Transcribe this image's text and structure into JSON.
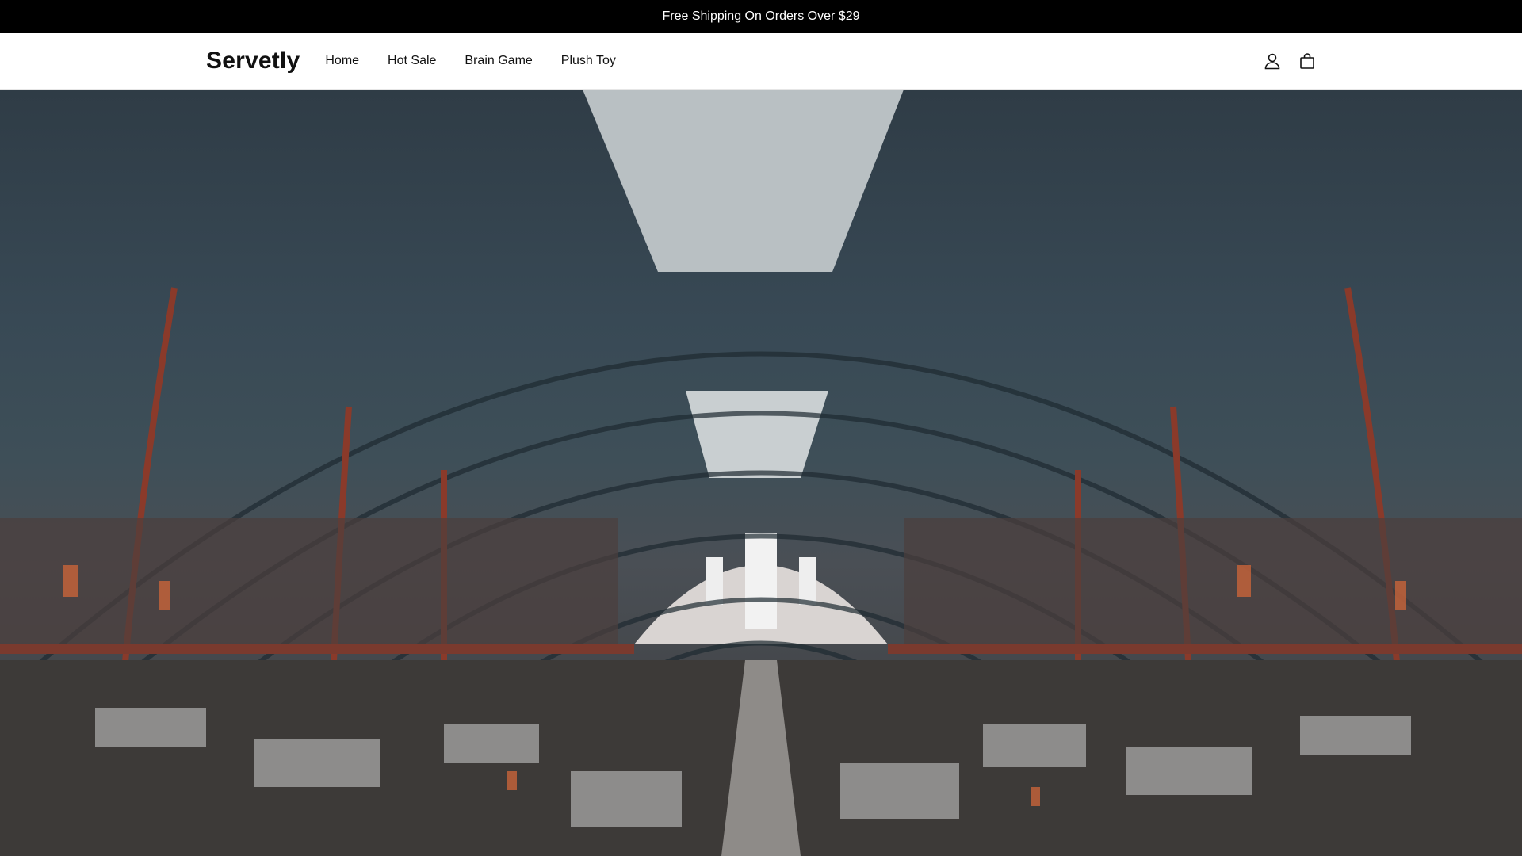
{
  "announcement": {
    "text": "Free Shipping On Orders Over $29"
  },
  "header": {
    "logo": "Servetly",
    "nav": [
      {
        "label": "Home"
      },
      {
        "label": "Hot Sale"
      },
      {
        "label": "Brain Game"
      },
      {
        "label": "Plush Toy"
      }
    ],
    "icons": [
      "account-icon",
      "cart-icon"
    ]
  },
  "hero": {
    "image": "market-hall-photo"
  },
  "colors": {
    "announcement_bg": "#000000",
    "header_bg": "#ffffff",
    "text": "#111111"
  }
}
